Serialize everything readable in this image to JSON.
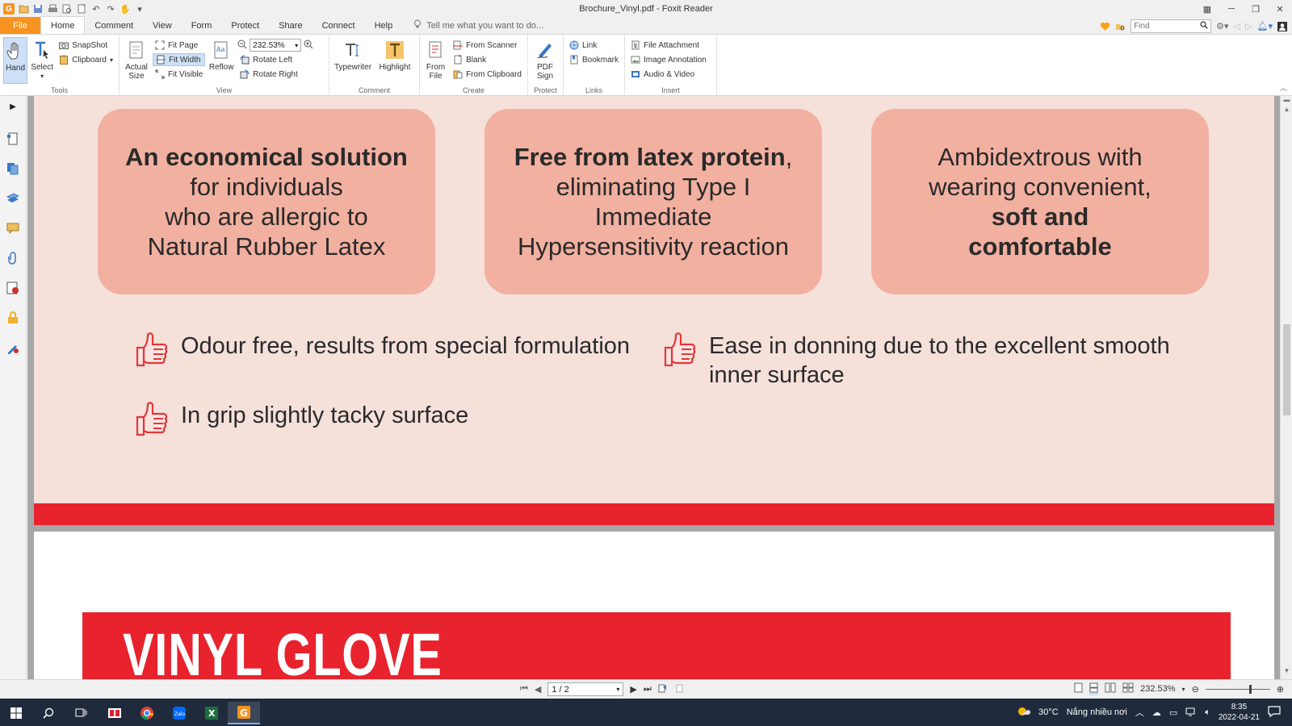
{
  "window": {
    "title": "Brochure_Vinyl.pdf - Foxit Reader",
    "app_logo_letter": "G"
  },
  "menu": {
    "tabs": [
      "File",
      "Home",
      "Comment",
      "View",
      "Form",
      "Protect",
      "Share",
      "Connect",
      "Help"
    ],
    "active_tab": "Home",
    "tell_me_placeholder": "Tell me what you want to do...",
    "find_placeholder": "Find"
  },
  "ribbon": {
    "tools": {
      "label": "Tools",
      "hand": "Hand",
      "select": "Select",
      "snapshot": "SnapShot",
      "clipboard": "Clipboard"
    },
    "view": {
      "label": "View",
      "actual_size_1": "Actual",
      "actual_size_2": "Size",
      "fit_page": "Fit Page",
      "fit_width": "Fit Width",
      "fit_visible": "Fit Visible",
      "reflow": "Reflow",
      "zoom_value": "232.53%",
      "rotate_left": "Rotate Left",
      "rotate_right": "Rotate Right"
    },
    "comment": {
      "label": "Comment",
      "typewriter": "Typewriter",
      "highlight": "Highlight"
    },
    "create": {
      "label": "Create",
      "from_file_1": "From",
      "from_file_2": "File",
      "from_scanner": "From Scanner",
      "blank": "Blank",
      "from_clipboard": "From Clipboard"
    },
    "protect": {
      "label": "Protect",
      "pdf_sign_1": "PDF",
      "pdf_sign_2": "Sign"
    },
    "links": {
      "label": "Links",
      "link": "Link",
      "bookmark": "Bookmark"
    },
    "insert": {
      "label": "Insert",
      "file_attachment": "File Attachment",
      "image_annotation": "Image Annotation",
      "audio_video": "Audio & Video"
    }
  },
  "document": {
    "cards": [
      {
        "bold": "An economical solution",
        "lines": [
          "for individuals",
          "who are allergic to",
          "Natural Rubber Latex"
        ]
      },
      {
        "bold": "Free from latex protein",
        "suffix": ",",
        "lines": [
          "eliminating Type I",
          "Immediate",
          "Hypersensitivity reaction"
        ]
      },
      {
        "lines": [
          "Ambidextrous with",
          "wearing convenient,"
        ],
        "bold_lines": [
          "soft and",
          "comfortable"
        ]
      }
    ],
    "features": [
      {
        "lines": [
          "Odour free, results from special formulation"
        ]
      },
      {
        "lines": [
          "Ease in donning due to the excellent smooth",
          "inner surface"
        ]
      },
      {
        "lines": [
          "In grip slightly tacky surface"
        ]
      }
    ],
    "banner_title": "VINYL GLOVE",
    "colors": {
      "page_bg": "#f5e0da",
      "card_bg": "#f2b0a0",
      "brand_red": "#e8232d",
      "thumb_red": "#e0373b"
    }
  },
  "status": {
    "page_indicator": "1 / 2",
    "zoom_value": "232.53%"
  },
  "taskbar": {
    "weather_temp": "30°C",
    "weather_desc": "Nắng nhiều nơi",
    "time": "8:35",
    "date": "2022-04-21"
  }
}
